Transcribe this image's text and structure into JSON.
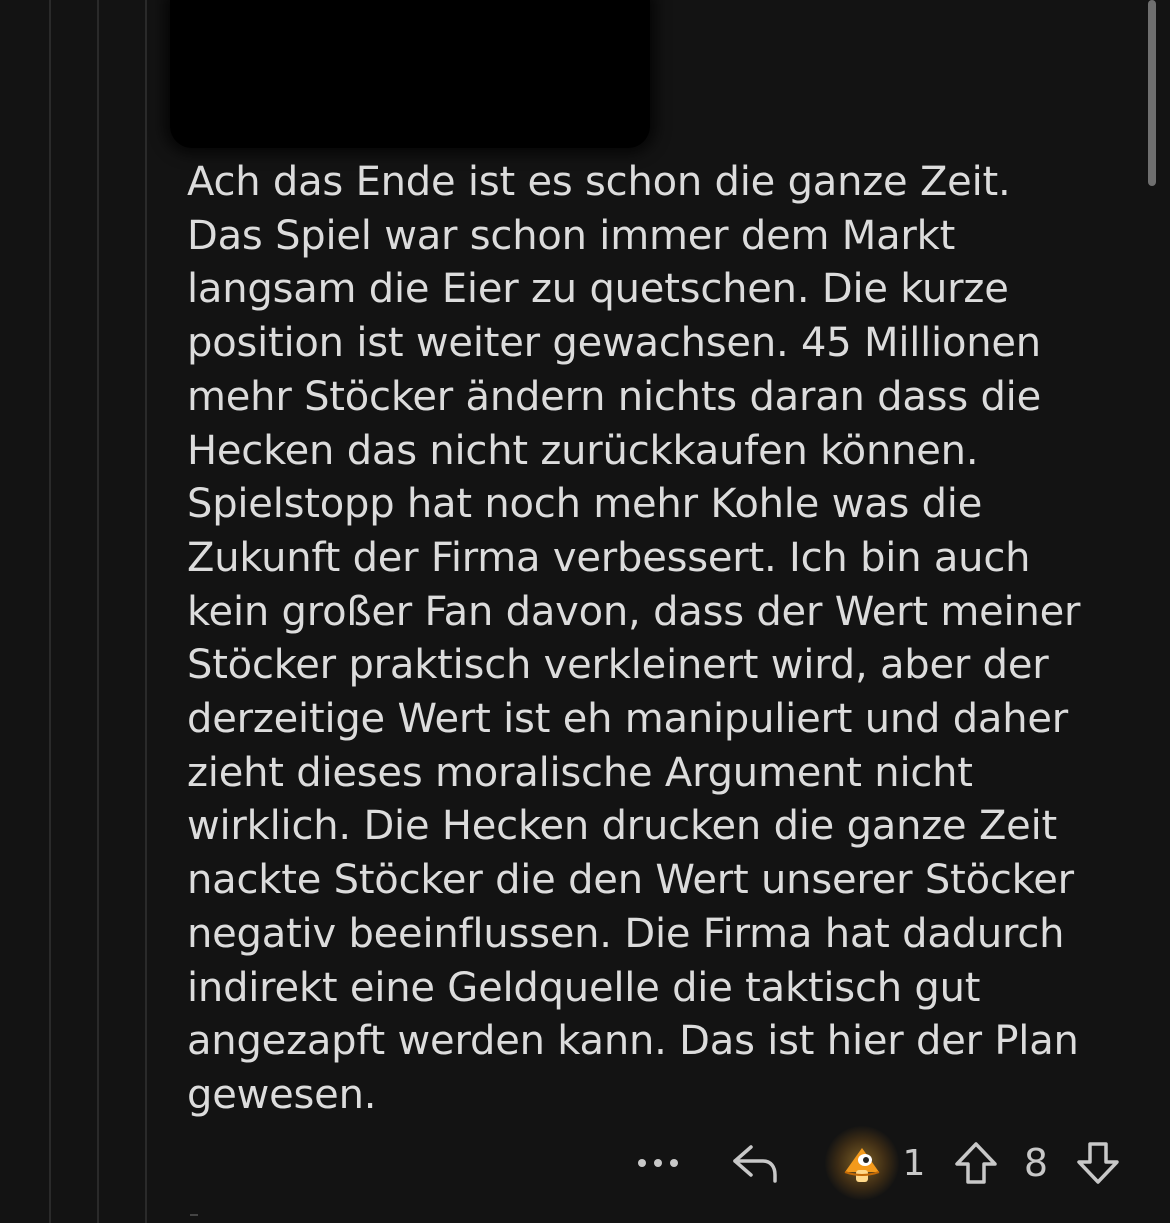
{
  "comment": {
    "lines": [
      "Ach das Ende ist es schon die ganze Zeit.",
      "Das Spiel war schon immer dem Markt",
      "langsam die Eier zu quetschen. Die kurze",
      "position ist weiter gewachsen. 45 Millionen",
      "mehr Stöcker ändern nichts daran dass die",
      "Hecken das nicht zurückkaufen können.",
      "Spielstopp hat noch mehr Kohle was die",
      "Zukunft der Firma verbessert. Ich bin auch",
      "kein großer Fan davon, dass der Wert meiner",
      "Stöcker praktisch verkleinert wird, aber der",
      "derzeitige Wert ist eh manipuliert und daher",
      "zieht dieses moralische Argument nicht",
      "wirklich. Die Hecken drucken die ganze Zeit",
      "nackte Stöcker die den Wert unserer Stöcker",
      "negativ beeinflussen. Die Firma hat dadurch",
      "indirekt eine Geldquelle die taktisch gut",
      "angezapft werden kann. Das ist hier der Plan",
      "gewesen."
    ]
  },
  "actions": {
    "more_icon": "more-dots-icon",
    "reply_icon": "reply-arrow-icon",
    "award_icon": "award-icon",
    "award_count": "1",
    "upvote_icon": "upvote-arrow-icon",
    "score": "8",
    "downvote_icon": "downvote-arrow-icon"
  },
  "colors": {
    "background": "#131313",
    "text": "#dcdcdc",
    "thread_line": "#2a2a2a",
    "award_orange": "#f39a1c"
  }
}
